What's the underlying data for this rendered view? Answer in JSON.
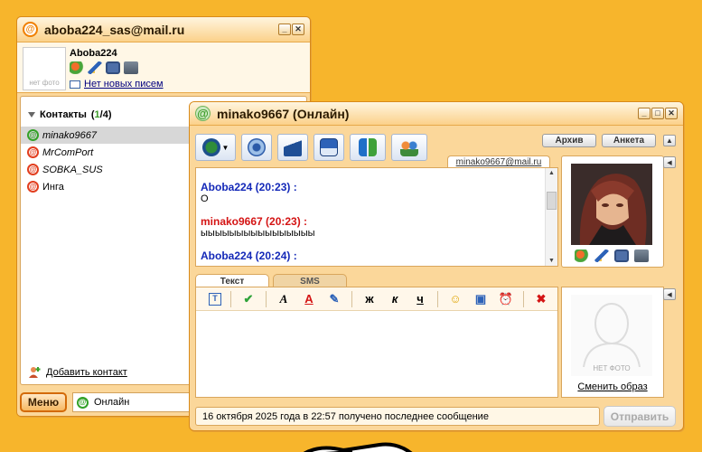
{
  "contact_list": {
    "title": "aboba224_sas@mail.ru",
    "profile": {
      "avatar_text": "нет фото",
      "name": "Aboba224",
      "mail_status": "Нет новых писем"
    },
    "contacts_label": "Контакты",
    "contacts_count_open": "(",
    "contacts_online": "1",
    "contacts_sep": "/4)",
    "contacts": [
      {
        "name": "minako9667",
        "status": "online"
      },
      {
        "name": "MrComPort",
        "status": "offline"
      },
      {
        "name": "SOBKA_SUS",
        "status": "offline"
      },
      {
        "name": "Инга",
        "status": "offline"
      }
    ],
    "add_contact": "Добавить контакт",
    "menu_label": "Меню",
    "status_label": "Онлайн"
  },
  "chat": {
    "title": "minako9667 (Онлайн)",
    "archive_label": "Архив",
    "profile_label": "Анкета",
    "contact_email": "minako9667@mail.ru",
    "messages": [
      {
        "author": "Aboba224 (20:23) :",
        "text": "О"
      },
      {
        "author": "minako9667 (20:23) :",
        "text": "ыыыыыыыыыыыыыыыы"
      },
      {
        "author": "Aboba224 (20:24) :",
        "text": ""
      }
    ],
    "tabs": [
      "Текст",
      "SMS"
    ],
    "format_bold": "ж",
    "format_italic": "к",
    "format_underline": "ч",
    "format_font": "A",
    "my_photo_text": "НЕТ ФОТО",
    "change_image": "Сменить образ",
    "status_message": "16 октября 2025 года в 22:57 получено последнее сообщение",
    "send_label": "Отправить"
  },
  "colors": {
    "desktop": "#f7b52c",
    "window": "#fbd79a",
    "accent": "#f08000",
    "my_name": "#1328b8",
    "their_name": "#d41414"
  }
}
